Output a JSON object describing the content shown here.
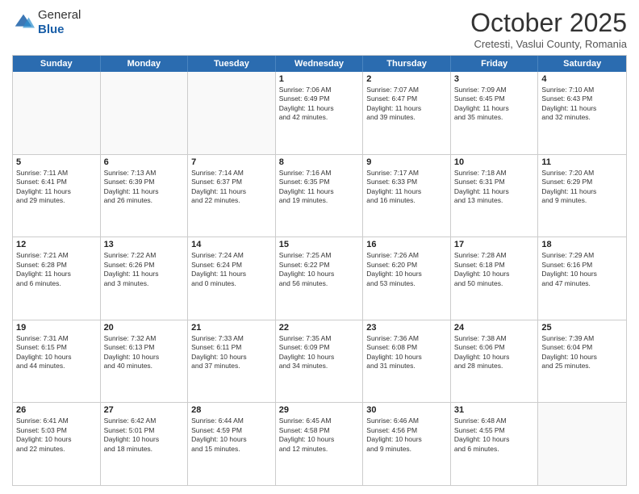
{
  "logo": {
    "general": "General",
    "blue": "Blue"
  },
  "header": {
    "month": "October 2025",
    "location": "Cretesti, Vaslui County, Romania"
  },
  "day_headers": [
    "Sunday",
    "Monday",
    "Tuesday",
    "Wednesday",
    "Thursday",
    "Friday",
    "Saturday"
  ],
  "weeks": [
    [
      {
        "day": "",
        "info": ""
      },
      {
        "day": "",
        "info": ""
      },
      {
        "day": "",
        "info": ""
      },
      {
        "day": "1",
        "info": "Sunrise: 7:06 AM\nSunset: 6:49 PM\nDaylight: 11 hours\nand 42 minutes."
      },
      {
        "day": "2",
        "info": "Sunrise: 7:07 AM\nSunset: 6:47 PM\nDaylight: 11 hours\nand 39 minutes."
      },
      {
        "day": "3",
        "info": "Sunrise: 7:09 AM\nSunset: 6:45 PM\nDaylight: 11 hours\nand 35 minutes."
      },
      {
        "day": "4",
        "info": "Sunrise: 7:10 AM\nSunset: 6:43 PM\nDaylight: 11 hours\nand 32 minutes."
      }
    ],
    [
      {
        "day": "5",
        "info": "Sunrise: 7:11 AM\nSunset: 6:41 PM\nDaylight: 11 hours\nand 29 minutes."
      },
      {
        "day": "6",
        "info": "Sunrise: 7:13 AM\nSunset: 6:39 PM\nDaylight: 11 hours\nand 26 minutes."
      },
      {
        "day": "7",
        "info": "Sunrise: 7:14 AM\nSunset: 6:37 PM\nDaylight: 11 hours\nand 22 minutes."
      },
      {
        "day": "8",
        "info": "Sunrise: 7:16 AM\nSunset: 6:35 PM\nDaylight: 11 hours\nand 19 minutes."
      },
      {
        "day": "9",
        "info": "Sunrise: 7:17 AM\nSunset: 6:33 PM\nDaylight: 11 hours\nand 16 minutes."
      },
      {
        "day": "10",
        "info": "Sunrise: 7:18 AM\nSunset: 6:31 PM\nDaylight: 11 hours\nand 13 minutes."
      },
      {
        "day": "11",
        "info": "Sunrise: 7:20 AM\nSunset: 6:29 PM\nDaylight: 11 hours\nand 9 minutes."
      }
    ],
    [
      {
        "day": "12",
        "info": "Sunrise: 7:21 AM\nSunset: 6:28 PM\nDaylight: 11 hours\nand 6 minutes."
      },
      {
        "day": "13",
        "info": "Sunrise: 7:22 AM\nSunset: 6:26 PM\nDaylight: 11 hours\nand 3 minutes."
      },
      {
        "day": "14",
        "info": "Sunrise: 7:24 AM\nSunset: 6:24 PM\nDaylight: 11 hours\nand 0 minutes."
      },
      {
        "day": "15",
        "info": "Sunrise: 7:25 AM\nSunset: 6:22 PM\nDaylight: 10 hours\nand 56 minutes."
      },
      {
        "day": "16",
        "info": "Sunrise: 7:26 AM\nSunset: 6:20 PM\nDaylight: 10 hours\nand 53 minutes."
      },
      {
        "day": "17",
        "info": "Sunrise: 7:28 AM\nSunset: 6:18 PM\nDaylight: 10 hours\nand 50 minutes."
      },
      {
        "day": "18",
        "info": "Sunrise: 7:29 AM\nSunset: 6:16 PM\nDaylight: 10 hours\nand 47 minutes."
      }
    ],
    [
      {
        "day": "19",
        "info": "Sunrise: 7:31 AM\nSunset: 6:15 PM\nDaylight: 10 hours\nand 44 minutes."
      },
      {
        "day": "20",
        "info": "Sunrise: 7:32 AM\nSunset: 6:13 PM\nDaylight: 10 hours\nand 40 minutes."
      },
      {
        "day": "21",
        "info": "Sunrise: 7:33 AM\nSunset: 6:11 PM\nDaylight: 10 hours\nand 37 minutes."
      },
      {
        "day": "22",
        "info": "Sunrise: 7:35 AM\nSunset: 6:09 PM\nDaylight: 10 hours\nand 34 minutes."
      },
      {
        "day": "23",
        "info": "Sunrise: 7:36 AM\nSunset: 6:08 PM\nDaylight: 10 hours\nand 31 minutes."
      },
      {
        "day": "24",
        "info": "Sunrise: 7:38 AM\nSunset: 6:06 PM\nDaylight: 10 hours\nand 28 minutes."
      },
      {
        "day": "25",
        "info": "Sunrise: 7:39 AM\nSunset: 6:04 PM\nDaylight: 10 hours\nand 25 minutes."
      }
    ],
    [
      {
        "day": "26",
        "info": "Sunrise: 6:41 AM\nSunset: 5:03 PM\nDaylight: 10 hours\nand 22 minutes."
      },
      {
        "day": "27",
        "info": "Sunrise: 6:42 AM\nSunset: 5:01 PM\nDaylight: 10 hours\nand 18 minutes."
      },
      {
        "day": "28",
        "info": "Sunrise: 6:44 AM\nSunset: 4:59 PM\nDaylight: 10 hours\nand 15 minutes."
      },
      {
        "day": "29",
        "info": "Sunrise: 6:45 AM\nSunset: 4:58 PM\nDaylight: 10 hours\nand 12 minutes."
      },
      {
        "day": "30",
        "info": "Sunrise: 6:46 AM\nSunset: 4:56 PM\nDaylight: 10 hours\nand 9 minutes."
      },
      {
        "day": "31",
        "info": "Sunrise: 6:48 AM\nSunset: 4:55 PM\nDaylight: 10 hours\nand 6 minutes."
      },
      {
        "day": "",
        "info": ""
      }
    ]
  ]
}
